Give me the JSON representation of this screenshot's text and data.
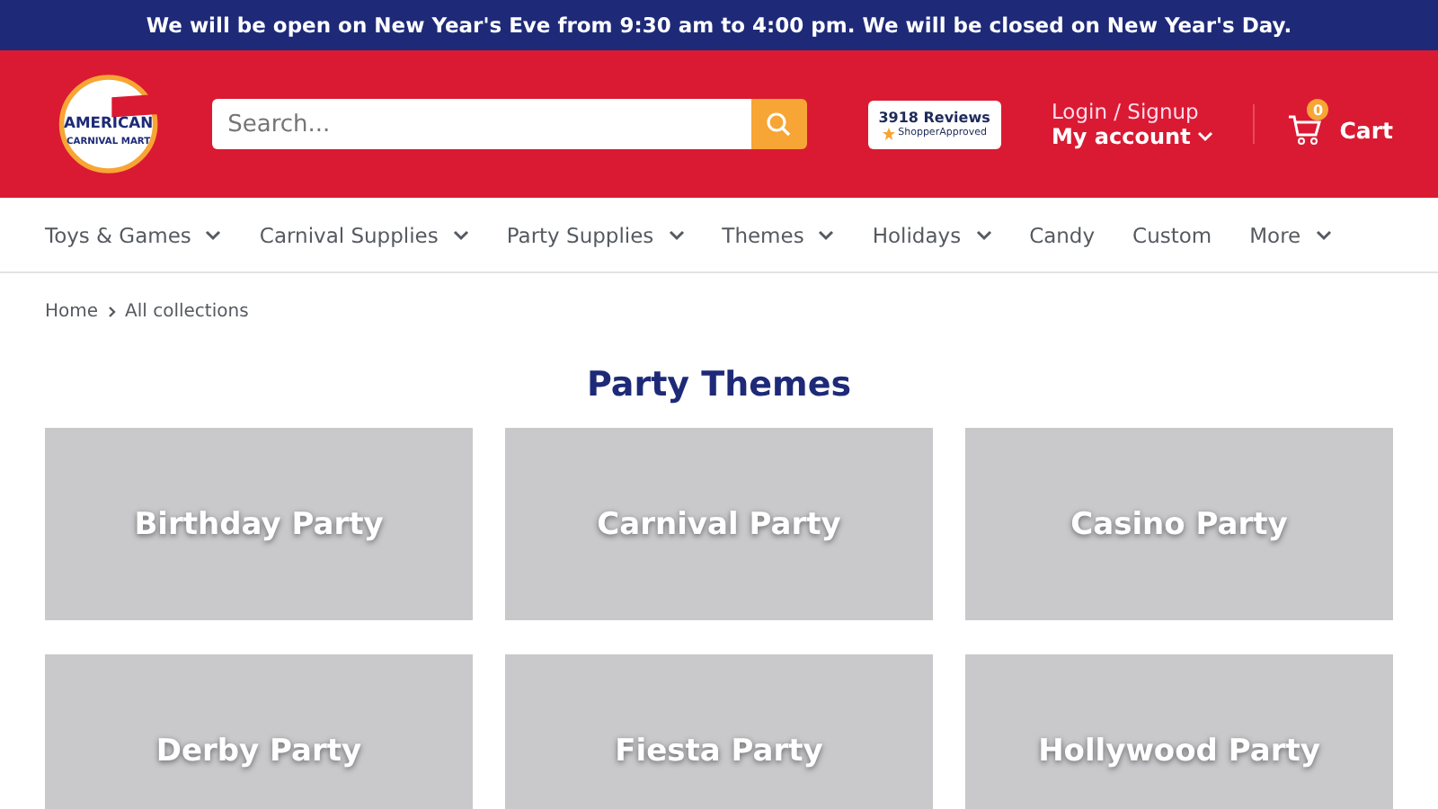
{
  "announcement": "We will be open on New Year's Eve from 9:30 am to 4:00 pm. We will be closed on New Year's Day.",
  "logo": {
    "top": "AMERICAN",
    "bottom": "CARNIVAL MART"
  },
  "search": {
    "placeholder": "Search..."
  },
  "reviews": {
    "count": "3918 Reviews",
    "brand": "ShopperApproved"
  },
  "account": {
    "login": "Login / Signup",
    "label": "My account"
  },
  "cart": {
    "count": "0",
    "label": "Cart"
  },
  "nav": [
    {
      "label": "Toys & Games",
      "dropdown": true
    },
    {
      "label": "Carnival Supplies",
      "dropdown": true
    },
    {
      "label": "Party Supplies",
      "dropdown": true
    },
    {
      "label": "Themes",
      "dropdown": true
    },
    {
      "label": "Holidays",
      "dropdown": true
    },
    {
      "label": "Candy",
      "dropdown": false
    },
    {
      "label": "Custom",
      "dropdown": false
    },
    {
      "label": "More",
      "dropdown": true
    }
  ],
  "breadcrumbs": [
    "Home",
    "All collections"
  ],
  "heading": "Party Themes",
  "collections": [
    {
      "title": "Birthday Party"
    },
    {
      "title": "Carnival Party"
    },
    {
      "title": "Casino Party"
    },
    {
      "title": "Derby Party"
    },
    {
      "title": "Fiesta Party"
    },
    {
      "title": "Hollywood Party"
    }
  ]
}
